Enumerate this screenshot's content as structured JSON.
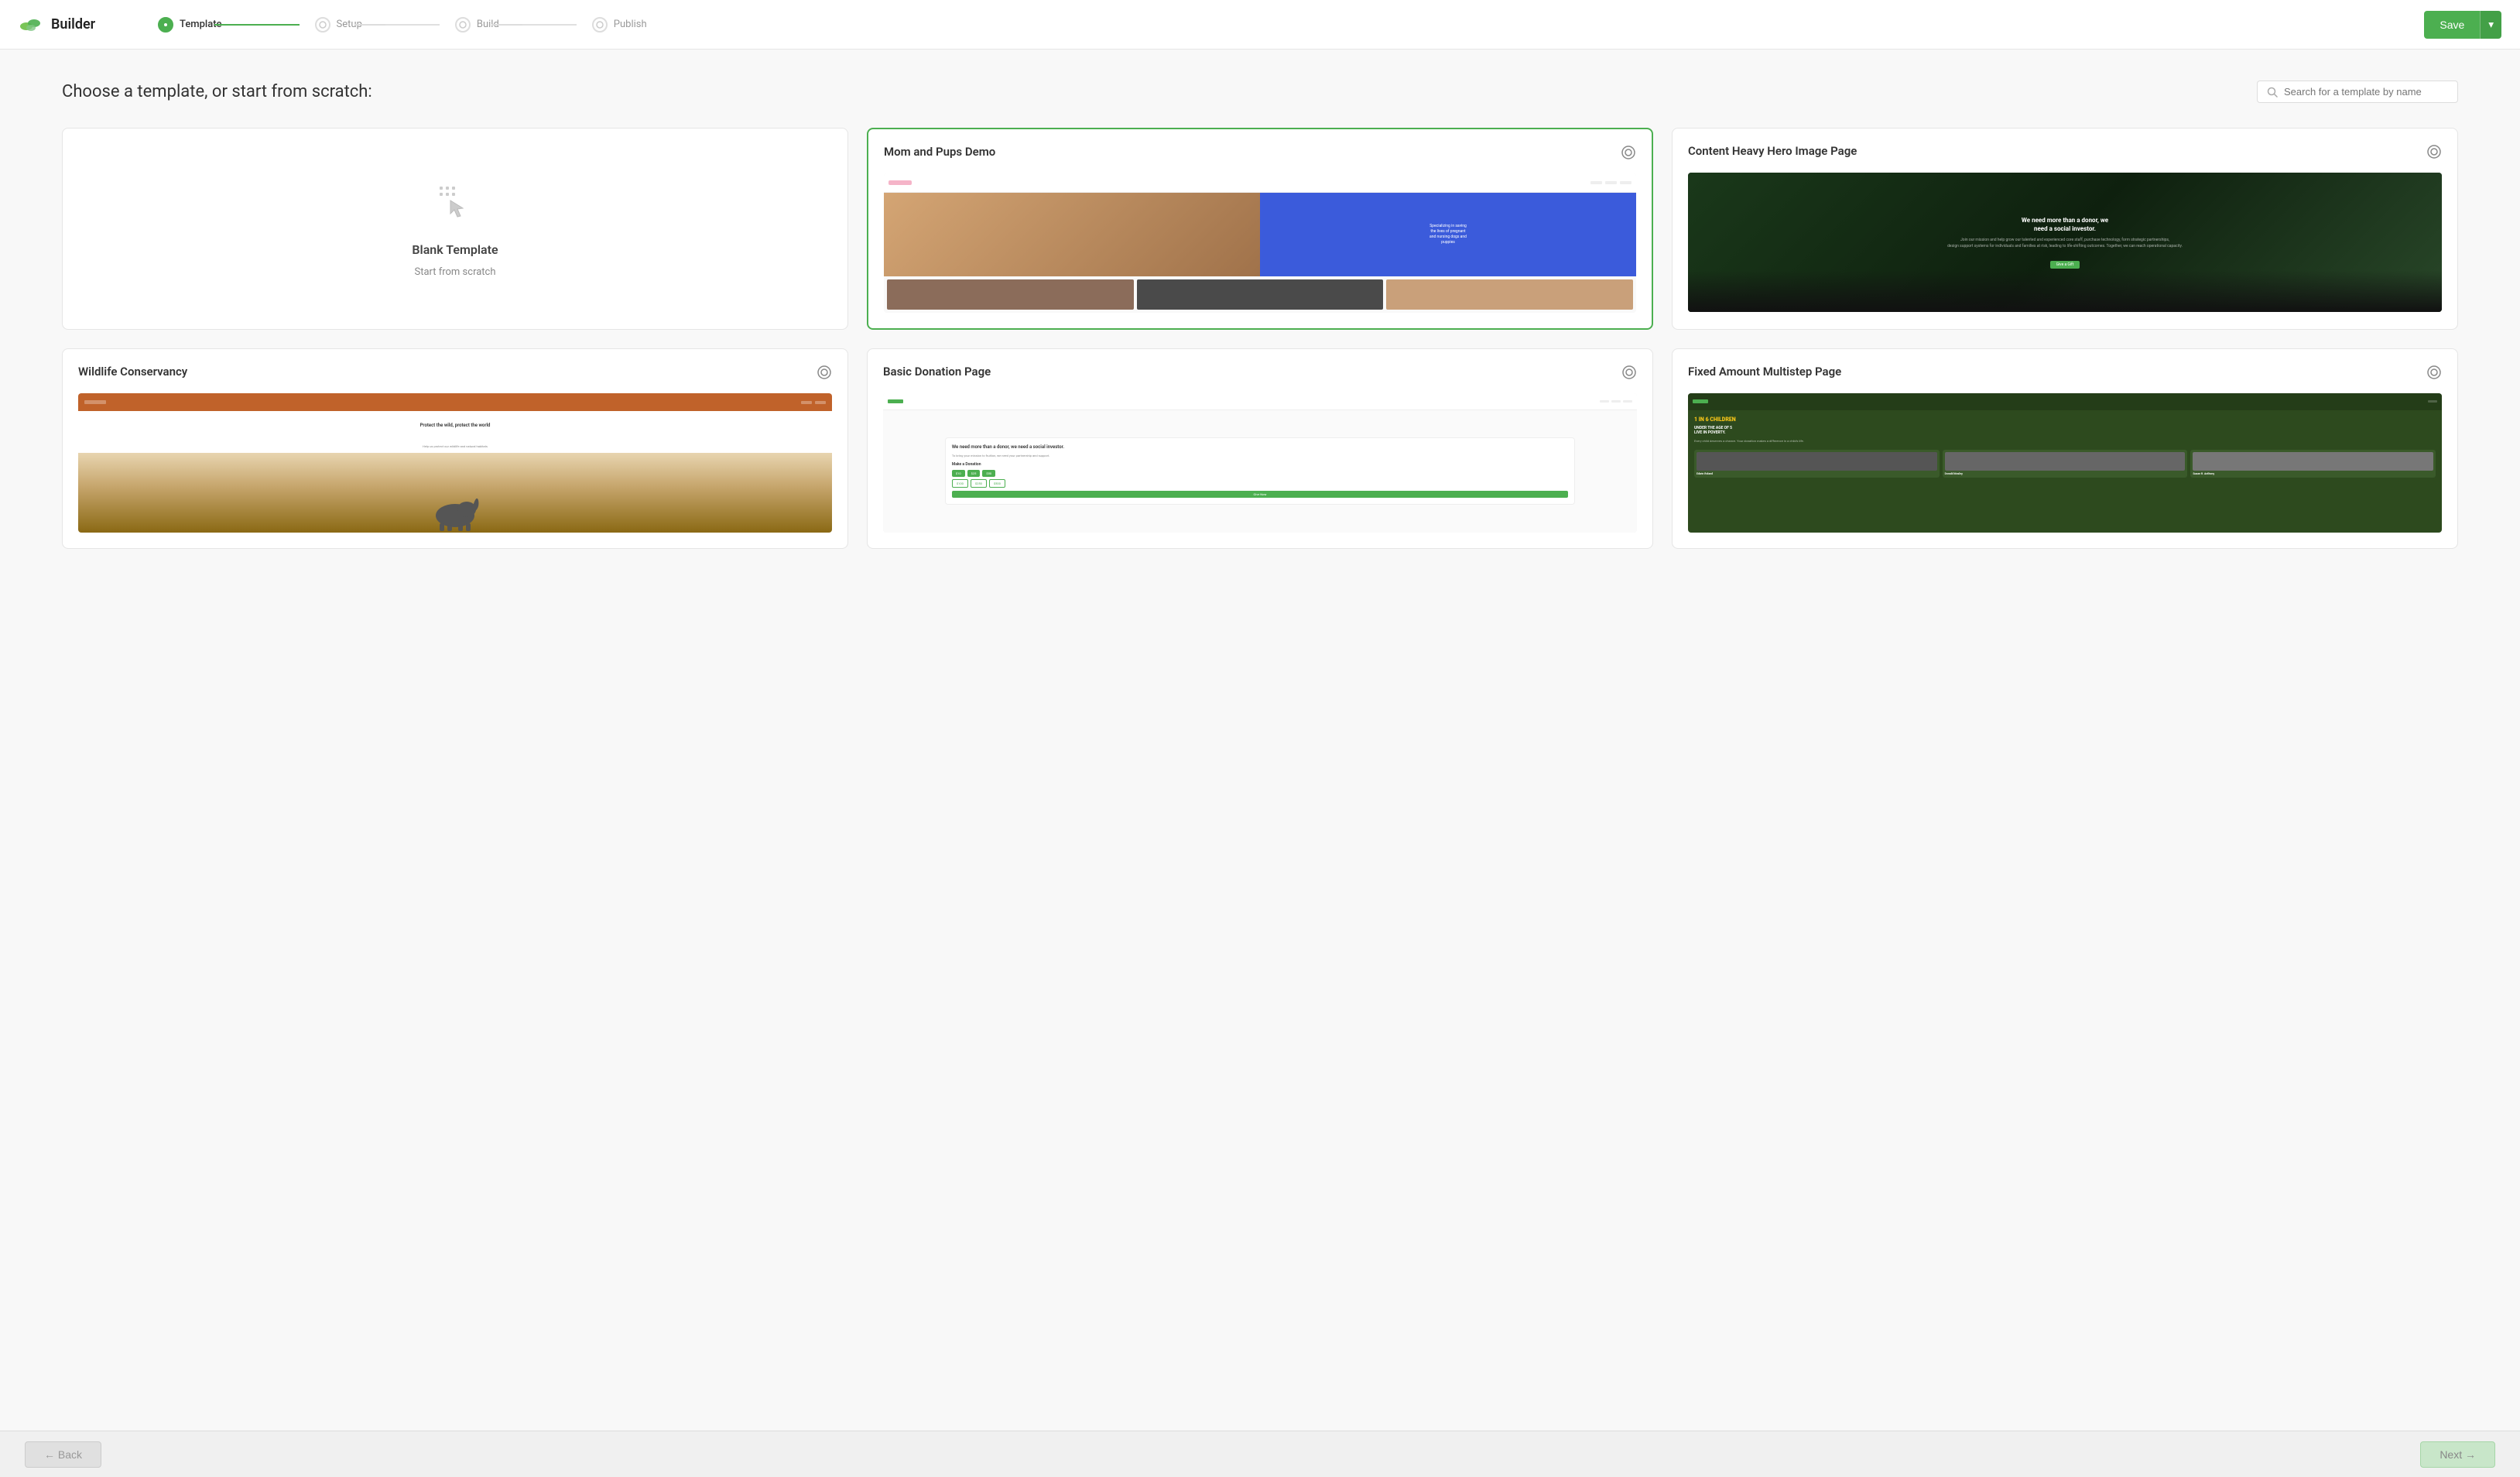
{
  "app": {
    "name": "Builder"
  },
  "header": {
    "save_label": "Save",
    "dropdown_label": "▾"
  },
  "stepper": {
    "steps": [
      {
        "id": "template",
        "label": "Template",
        "state": "active"
      },
      {
        "id": "setup",
        "label": "Setup",
        "state": "inactive"
      },
      {
        "id": "build",
        "label": "Build",
        "state": "inactive"
      },
      {
        "id": "publish",
        "label": "Publish",
        "state": "inactive"
      }
    ]
  },
  "main": {
    "page_title": "Choose a template, or start from scratch:",
    "search_placeholder": "Search for a template by name"
  },
  "templates": [
    {
      "id": "blank",
      "name": "Blank Template",
      "subtitle": "Start from scratch",
      "type": "blank",
      "selected": false
    },
    {
      "id": "mom-pups",
      "name": "Mom and Pups Demo",
      "type": "preview",
      "selected": true,
      "preview_type": "mom-pups"
    },
    {
      "id": "content-heavy",
      "name": "Content Heavy Hero Image Page",
      "type": "preview",
      "selected": false,
      "preview_type": "content-heavy"
    },
    {
      "id": "wildlife",
      "name": "Wildlife Conservancy",
      "type": "preview",
      "selected": false,
      "preview_type": "wildlife"
    },
    {
      "id": "basic-donation",
      "name": "Basic Donation Page",
      "type": "preview",
      "selected": false,
      "preview_type": "basic-donation"
    },
    {
      "id": "fixed-amount",
      "name": "Fixed Amount Multistep Page",
      "type": "preview",
      "selected": false,
      "preview_type": "fixed-amount"
    }
  ],
  "footer": {
    "back_label": "← Back",
    "next_label": "Next →"
  }
}
